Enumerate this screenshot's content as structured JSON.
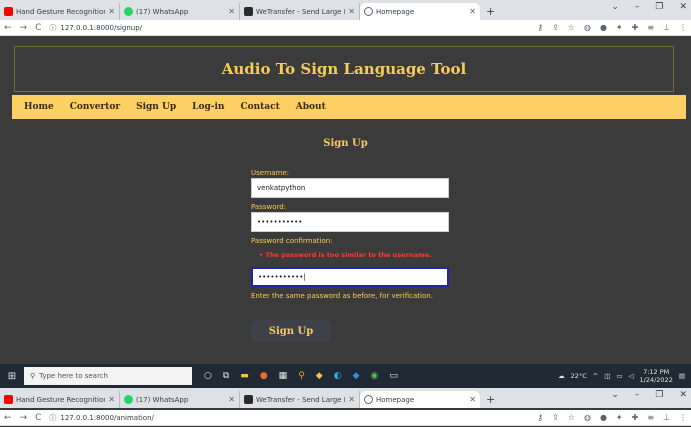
{
  "browser": {
    "tabs": [
      {
        "title": "Hand Gesture Recognition using",
        "icon": "youtube-icon"
      },
      {
        "title": "(17) WhatsApp",
        "icon": "whatsapp-icon"
      },
      {
        "title": "WeTransfer - Send Large Files &",
        "icon": "wetransfer-icon"
      },
      {
        "title": "Homepage",
        "icon": "globe-icon"
      }
    ],
    "url": "127.0.0.1:8000/signup/"
  },
  "app": {
    "title": "Audio To Sign Language Tool",
    "nav": [
      "Home",
      "Convertor",
      "Sign Up",
      "Log-in",
      "Contact",
      "About"
    ]
  },
  "form": {
    "heading": "Sign Up",
    "username_label": "Username:",
    "username_value": "venkatpython",
    "password_label": "Password:",
    "password_value": "•••••••••••",
    "confirm_label": "Password confirmation:",
    "error": "The password is too similar to the username.",
    "confirm_value": "•••••••••••|",
    "help_text": "Enter the same password as before, for verification.",
    "submit_label": "Sign Up"
  },
  "taskbar": {
    "search_placeholder": "Type here to search",
    "temperature": "22°C",
    "time": "7:12 PM",
    "date": "1/24/2022"
  },
  "browser2": {
    "url": "127.0.0.1:8000/animation/"
  }
}
